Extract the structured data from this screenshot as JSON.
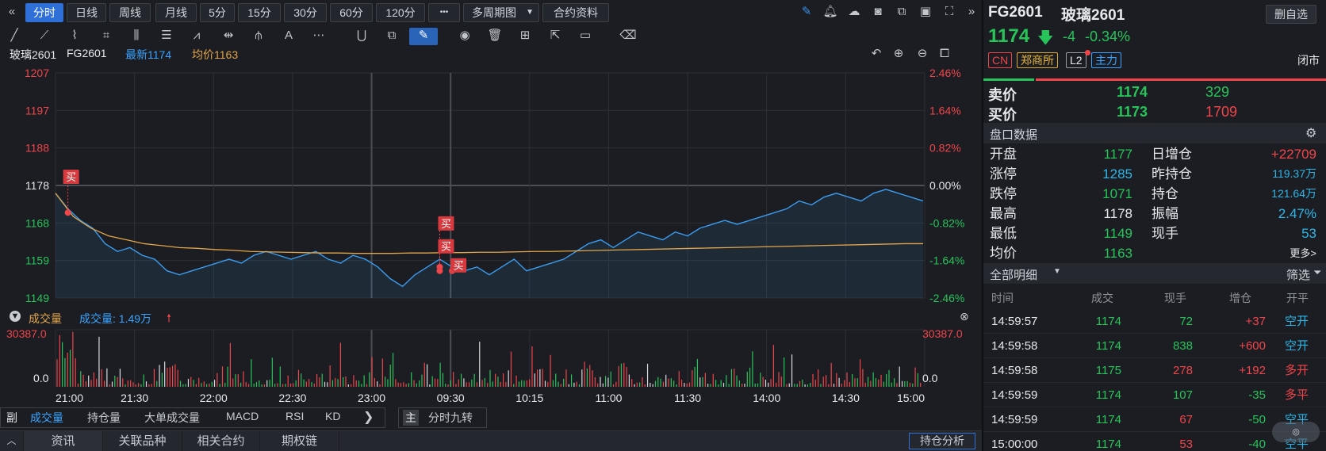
{
  "toolbar": {
    "collapse_icon": "«",
    "periods": [
      "分时",
      "日线",
      "周线",
      "月线",
      "5分",
      "15分",
      "30分",
      "60分",
      "120分"
    ],
    "more_label": "•••",
    "multi_period_label": "多周期图",
    "contract_info_label": "合约资料",
    "expand_icon": "»"
  },
  "info": {
    "name": "玻璃2601",
    "code": "FG2601",
    "latest_label": "最新1174",
    "avg_label": "均价1163"
  },
  "chart_data": {
    "type": "line",
    "x_tick_labels": [
      "21:00",
      "21:30",
      "22:00",
      "22:30",
      "23:00",
      "09:30",
      "10:15",
      "11:00",
      "11:30",
      "14:00",
      "14:30",
      "15:00"
    ],
    "y_left_ticks": [
      "1207",
      "1197",
      "1188",
      "1178",
      "1168",
      "1159",
      "1149"
    ],
    "y_right_ticks": [
      "2.46%",
      "1.64%",
      "0.82%",
      "0.00%",
      "-0.82%",
      "-1.64%",
      "-2.46%"
    ],
    "ylim": [
      1149,
      1207
    ],
    "prev_close": 1178,
    "series": [
      {
        "name": "最新",
        "color": "#3a9cf0",
        "values": [
          1176,
          1172,
          1169,
          1167,
          1163,
          1161,
          1162,
          1160,
          1159,
          1156,
          1155,
          1156,
          1157,
          1158,
          1159,
          1158,
          1160,
          1161,
          1160,
          1159,
          1160,
          1161,
          1159,
          1158,
          1160,
          1159,
          1157,
          1154,
          1152,
          1155,
          1157,
          1159,
          1157,
          1156,
          1157,
          1155,
          1157,
          1159,
          1156,
          1157,
          1158,
          1159,
          1161,
          1163,
          1164,
          1162,
          1164,
          1166,
          1165,
          1164,
          1166,
          1165,
          1167,
          1168,
          1169,
          1168,
          1169,
          1170,
          1171,
          1172,
          1174,
          1173,
          1175,
          1176,
          1175,
          1174,
          1176,
          1177,
          1176,
          1175,
          1174
        ]
      },
      {
        "name": "均价",
        "color": "#e3a64a",
        "values": [
          1176,
          1170,
          1167,
          1165,
          1164,
          1163,
          1162.5,
          1162,
          1161.8,
          1161.5,
          1161.3,
          1161,
          1160.9,
          1160.8,
          1160.7,
          1160.6,
          1160.6,
          1160.5,
          1160.5,
          1160.5,
          1160.6,
          1160.6,
          1160.7,
          1160.7,
          1160.8,
          1160.8,
          1160.9,
          1161,
          1161,
          1161.1,
          1161.2,
          1161.3,
          1161.4,
          1161.5,
          1161.6,
          1161.7,
          1161.8,
          1161.9,
          1162,
          1162.1,
          1162.2,
          1162.3,
          1162.4,
          1162.5,
          1162.6,
          1162.7,
          1162.8,
          1162.9,
          1163,
          1163
        ]
      }
    ],
    "buy_marks": [
      {
        "label": "买",
        "x_index": 1,
        "price": 1171
      },
      {
        "label": "买",
        "x_index": 31,
        "price": 1157
      },
      {
        "label": "买",
        "x_index": 31,
        "price": 1156
      },
      {
        "label": "买",
        "x_index": 32,
        "price": 1156
      }
    ],
    "volume": {
      "title": "成交量",
      "label": "成交量: 1.49万",
      "ymax_label": "30387.0",
      "ymin_label": "0.0"
    }
  },
  "chart_icons": [
    "undo-icon",
    "zoom-in-icon",
    "zoom-out-icon",
    "layout-icon"
  ],
  "subtabs": {
    "prefix": "副",
    "items": [
      "成交量",
      "持仓量",
      "大单成交量",
      "MACD",
      "RSI",
      "KD"
    ],
    "main_prefix": "主",
    "main_item": "分时九转"
  },
  "bottom_tabs": [
    "资讯",
    "关联品种",
    "相关合约",
    "期权链"
  ],
  "bottom_right": "持仓分析",
  "quote": {
    "code": "FG2601",
    "name": "玻璃2601",
    "remove_label": "删自选",
    "price": "1174",
    "change": "-4",
    "change_pct": "-0.34%",
    "tags": [
      "CN",
      "郑商所",
      "L2",
      "主力"
    ],
    "status": "闭市",
    "ask_label": "卖价",
    "ask_price": "1174",
    "ask_vol": "329",
    "bid_label": "买价",
    "bid_price": "1173",
    "bid_vol": "1709",
    "panel_title": "盘口数据",
    "stats": [
      {
        "label": "开盘",
        "value": "1177",
        "label2": "日增仓",
        "value2": "+22709"
      },
      {
        "label": "涨停",
        "value": "1285",
        "label2": "昨持仓",
        "value2": "119.37万"
      },
      {
        "label": "跌停",
        "value": "1071",
        "label2": "持仓",
        "value2": "121.64万"
      },
      {
        "label": "最高",
        "value": "1178",
        "label2": "振幅",
        "value2": "2.47%"
      },
      {
        "label": "最低",
        "value": "1149",
        "label2": "现手",
        "value2": "53"
      },
      {
        "label": "均价",
        "value": "1163",
        "label2": "",
        "value2": "更多>"
      }
    ],
    "detail_title": "全部明细",
    "filter_label": "筛选",
    "trade_headers": [
      "时间",
      "成交",
      "现手",
      "增仓",
      "开平"
    ],
    "trades": [
      {
        "time": "14:59:57",
        "price": "1174",
        "vol": "72",
        "oi": "+37",
        "type": "空开"
      },
      {
        "time": "14:59:58",
        "price": "1174",
        "vol": "838",
        "oi": "+600",
        "type": "空开"
      },
      {
        "time": "14:59:58",
        "price": "1175",
        "vol": "278",
        "oi": "+192",
        "type": "多开"
      },
      {
        "time": "14:59:59",
        "price": "1174",
        "vol": "107",
        "oi": "-35",
        "type": "多平"
      },
      {
        "time": "14:59:59",
        "price": "1174",
        "vol": "67",
        "oi": "-50",
        "type": "空平"
      },
      {
        "time": "15:00:00",
        "price": "1174",
        "vol": "53",
        "oi": "-40",
        "type": "空平"
      }
    ]
  }
}
